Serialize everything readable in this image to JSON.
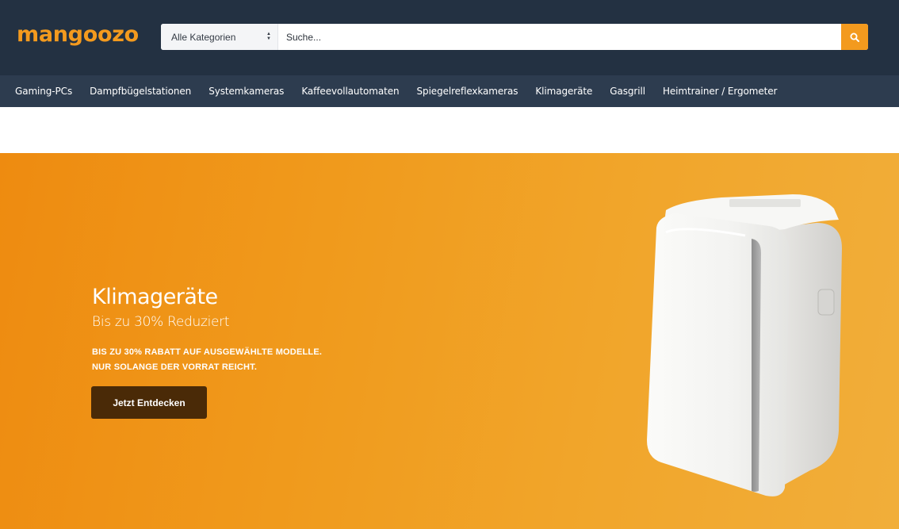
{
  "header": {
    "logo": "mangoozo",
    "search": {
      "category_selected": "Alle Kategorien",
      "placeholder": "Suche...",
      "button_icon": "search-icon"
    }
  },
  "nav": {
    "items": [
      "Gaming-PCs",
      "Dampfbügelstationen",
      "Systemkameras",
      "Kaffeevollautomaten",
      "Spiegelreflexkameras",
      "Klimageräte",
      "Gasgrill",
      "Heimtrainer / Ergometer"
    ]
  },
  "hero": {
    "title": "Klimageräte",
    "subtitle": "Bis zu 30% Reduziert",
    "text_lines": [
      "BIS ZU 30% RABATT AUF AUSGEWÄHLTE MODELLE.",
      "NUR SOLANGE DER VORRAT REICHT."
    ],
    "cta_label": "Jetzt Entdecken",
    "image_icon": "air-conditioner-image"
  },
  "colors": {
    "header_bg": "#233142",
    "nav_bg": "#2d3c4f",
    "accent": "#f39a1e",
    "cta_bg": "#4a2a07"
  }
}
